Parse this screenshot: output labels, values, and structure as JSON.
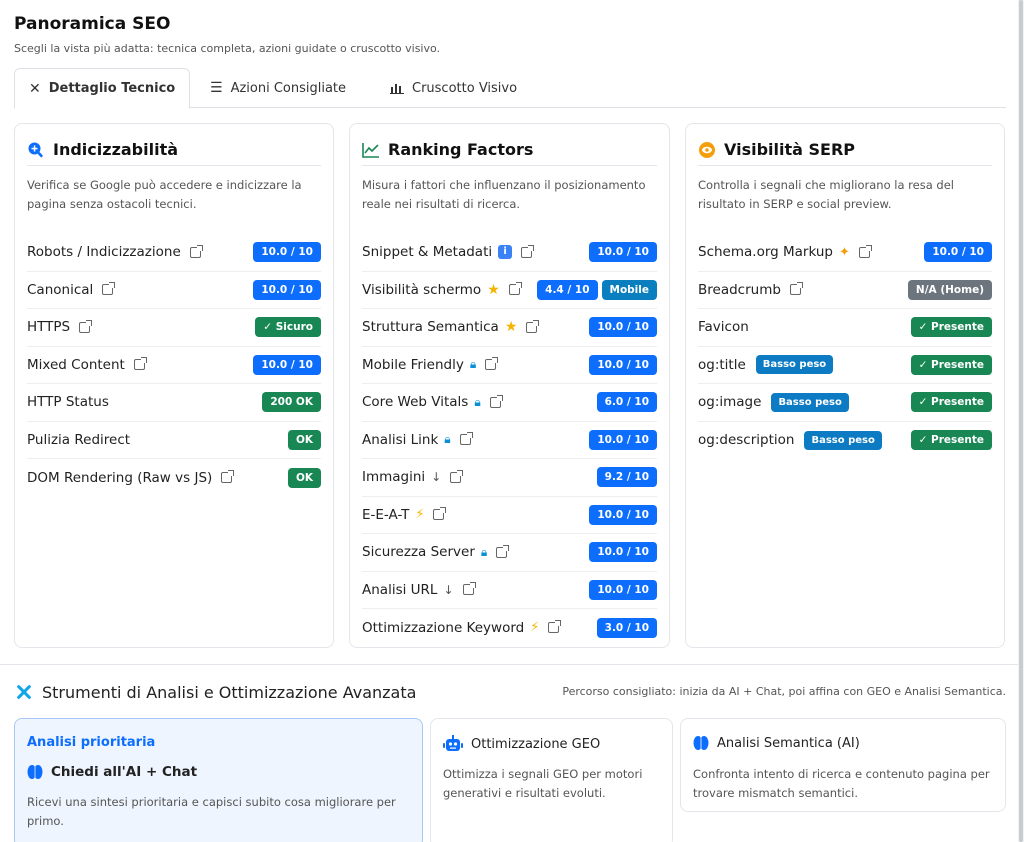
{
  "header": {
    "title": "Panoramica SEO",
    "subtitle": "Scegli la vista più adatta: tecnica completa, azioni guidate o cruscotto visivo."
  },
  "tabs": [
    {
      "label": "Dettaglio Tecnico",
      "icon": "tools-icon",
      "active": true
    },
    {
      "label": "Azioni Consigliate",
      "icon": "checklist-icon",
      "active": false
    },
    {
      "label": "Cruscotto Visivo",
      "icon": "bar-chart-icon",
      "active": false
    }
  ],
  "cards": {
    "indexability": {
      "title": "Indicizzabilità",
      "icon": "search-plus-icon",
      "description": "Verifica se Google può accedere e indicizzare la pagina senza ostacoli tecnici.",
      "rows": [
        {
          "label": "Robots / Indicizzazione",
          "badge": "10.0 / 10"
        },
        {
          "label": "Canonical",
          "badge": "10.0 / 10"
        },
        {
          "label": "HTTPS",
          "badge": "✓ Sicuro"
        },
        {
          "label": "Mixed Content",
          "badge": "10.0 / 10"
        },
        {
          "label": "HTTP Status",
          "badge": "200 OK"
        },
        {
          "label": "Pulizia Redirect",
          "badge": "OK"
        },
        {
          "label": "DOM Rendering (Raw vs JS)",
          "badge": "OK"
        }
      ]
    },
    "ranking": {
      "title": "Ranking Factors",
      "icon": "line-chart-icon",
      "description": "Misura i fattori che influenzano il posizionamento reale nei risultati di ricerca.",
      "rows": [
        {
          "label": "Snippet & Metadati",
          "badge": "10.0 / 10"
        },
        {
          "label": "Visibilità schermo",
          "badge": "4.4 / 10",
          "badge2": "Mobile"
        },
        {
          "label": "Struttura Semantica",
          "badge": "10.0 / 10"
        },
        {
          "label": "Mobile Friendly",
          "badge": "10.0 / 10"
        },
        {
          "label": "Core Web Vitals",
          "badge": "6.0 / 10"
        },
        {
          "label": "Analisi Link",
          "badge": "10.0 / 10"
        },
        {
          "label": "Immagini",
          "badge": "9.2 / 10"
        },
        {
          "label": "E-E-A-T",
          "badge": "10.0 / 10"
        },
        {
          "label": "Sicurezza Server",
          "badge": "10.0 / 10"
        },
        {
          "label": "Analisi URL",
          "badge": "10.0 / 10"
        },
        {
          "label": "Ottimizzazione Keyword",
          "badge": "3.0 / 10"
        }
      ]
    },
    "serp": {
      "title": "Visibilità SERP",
      "icon": "eye-icon",
      "description": "Controlla i segnali che migliorano la resa del risultato in SERP e social preview.",
      "rows": [
        {
          "label": "Schema.org Markup",
          "badge": "10.0 / 10"
        },
        {
          "label": "Breadcrumb",
          "badge": "N/A (Home)"
        },
        {
          "label": "Favicon",
          "badge": "✓ Presente"
        },
        {
          "label": "og:title",
          "tag": "Basso peso",
          "badge": "✓ Presente"
        },
        {
          "label": "og:image",
          "tag": "Basso peso",
          "badge": "✓ Presente"
        },
        {
          "label": "og:description",
          "tag": "Basso peso",
          "badge": "✓ Presente"
        }
      ]
    }
  },
  "tools": {
    "title": "Strumenti di Analisi e Ottimizzazione Avanzata",
    "hint": "Percorso consigliato: inizia da AI + Chat, poi affina con GEO e Analisi Semantica.",
    "items": [
      {
        "kicker": "Analisi prioritaria",
        "title": "Chiedi all'AI + Chat",
        "description": "Ricevi una sintesi prioritaria e capisci subito cosa migliorare per primo."
      },
      {
        "title": "Ottimizzazione GEO",
        "description": "Ottimizza i segnali GEO per motori generativi e risultati evoluti."
      },
      {
        "title": "Analisi Semantica (AI)",
        "description": "Confronta intento di ricerca e contenuto pagina per trovare mismatch semantici."
      }
    ]
  },
  "colors": {
    "primary": "#0d6efd",
    "success": "#198754",
    "secondary": "#6c757d",
    "info": "#0d7bc4"
  }
}
